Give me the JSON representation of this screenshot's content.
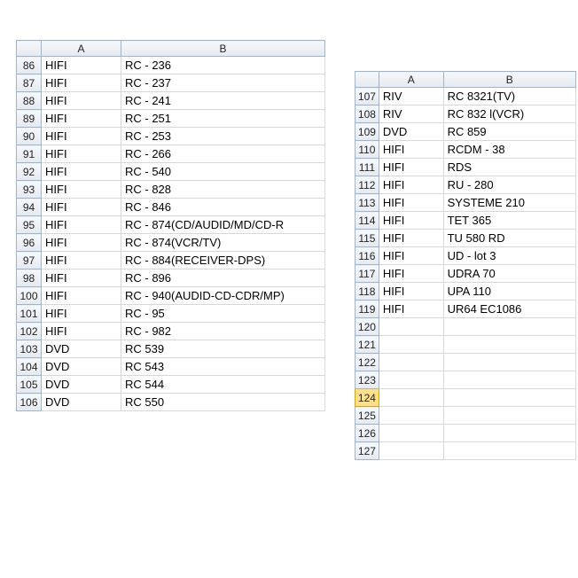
{
  "leftPane": {
    "columns": [
      "A",
      "B"
    ],
    "rows": [
      {
        "r": 86,
        "a": "HIFI",
        "b": "RC - 236"
      },
      {
        "r": 87,
        "a": "HIFI",
        "b": "RC - 237"
      },
      {
        "r": 88,
        "a": "HIFI",
        "b": "RC - 241"
      },
      {
        "r": 89,
        "a": "HIFI",
        "b": "RC - 251"
      },
      {
        "r": 90,
        "a": "HIFI",
        "b": "RC - 253"
      },
      {
        "r": 91,
        "a": "HIFI",
        "b": "RC - 266"
      },
      {
        "r": 92,
        "a": "HIFI",
        "b": "RC - 540"
      },
      {
        "r": 93,
        "a": "HIFI",
        "b": "RC - 828"
      },
      {
        "r": 94,
        "a": "HIFI",
        "b": "RC - 846"
      },
      {
        "r": 95,
        "a": "HIFI",
        "b": "RC - 874(CD/AUDID/MD/CD-R"
      },
      {
        "r": 96,
        "a": "HIFI",
        "b": "RC - 874(VCR/TV)"
      },
      {
        "r": 97,
        "a": "HIFI",
        "b": "RC - 884(RECEIVER-DPS)"
      },
      {
        "r": 98,
        "a": "HIFI",
        "b": "RC - 896"
      },
      {
        "r": 100,
        "a": "HIFI",
        "b": "RC - 940(AUDID-CD-CDR/MP)"
      },
      {
        "r": 101,
        "a": "HIFI",
        "b": "RC - 95"
      },
      {
        "r": 102,
        "a": "HIFI",
        "b": "RC - 982"
      },
      {
        "r": 103,
        "a": "DVD",
        "b": "RC 539"
      },
      {
        "r": 104,
        "a": "DVD",
        "b": "RC 543"
      },
      {
        "r": 105,
        "a": "DVD",
        "b": "RC 544"
      },
      {
        "r": 106,
        "a": "DVD",
        "b": "RC 550"
      }
    ]
  },
  "rightPane": {
    "columns": [
      "A",
      "B"
    ],
    "selectedRow": 124,
    "rows": [
      {
        "r": 107,
        "a": "RIV",
        "b": "RC 8321(TV)"
      },
      {
        "r": 108,
        "a": "RIV",
        "b": "RC 832 l(VCR)"
      },
      {
        "r": 109,
        "a": "DVD",
        "b": "RC 859"
      },
      {
        "r": 110,
        "a": "HIFI",
        "b": "RCDM - 38"
      },
      {
        "r": 111,
        "a": "HIFI",
        "b": "RDS"
      },
      {
        "r": 112,
        "a": "HIFI",
        "b": "RU - 280"
      },
      {
        "r": 113,
        "a": "HIFI",
        "b": "SYSTEME 210"
      },
      {
        "r": 114,
        "a": "HIFI",
        "b": "TET 365"
      },
      {
        "r": 115,
        "a": "HIFI",
        "b": "TU 580 RD"
      },
      {
        "r": 116,
        "a": "HIFI",
        "b": "UD - lot 3"
      },
      {
        "r": 117,
        "a": "HIFI",
        "b": "UDRA 70"
      },
      {
        "r": 118,
        "a": "HIFI",
        "b": "UPA 110"
      },
      {
        "r": 119,
        "a": "HIFI",
        "b": "UR64 EC1086"
      },
      {
        "r": 120,
        "a": "",
        "b": ""
      },
      {
        "r": 121,
        "a": "",
        "b": ""
      },
      {
        "r": 122,
        "a": "",
        "b": ""
      },
      {
        "r": 123,
        "a": "",
        "b": ""
      },
      {
        "r": 124,
        "a": "",
        "b": ""
      },
      {
        "r": 125,
        "a": "",
        "b": ""
      },
      {
        "r": 126,
        "a": "",
        "b": ""
      },
      {
        "r": 127,
        "a": "",
        "b": ""
      }
    ]
  }
}
